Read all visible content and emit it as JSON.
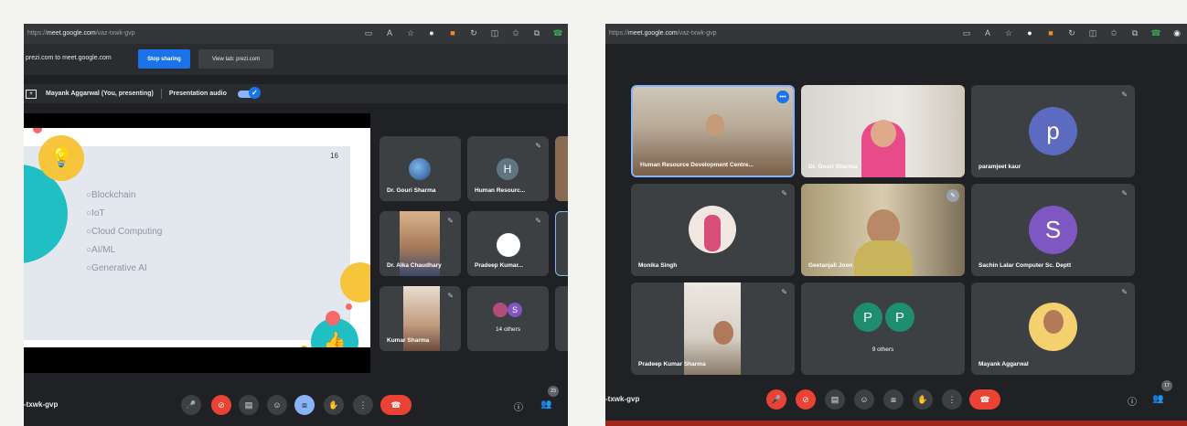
{
  "left": {
    "url": {
      "prefix": "https://",
      "host": "meet.google.com",
      "path": "/vaz-txwk-gvp"
    },
    "share": {
      "message": "prezi.com to meet.google.com",
      "stop": "Stop sharing",
      "view": "View tab: prezi.com"
    },
    "presenting": {
      "name": "Mayank Aggarwal (You, presenting)",
      "audio": "Presentation audio"
    },
    "slide": {
      "number": "16",
      "bullets": [
        "Blockchain",
        "IoT",
        "Cloud Computing",
        "AI/ML",
        "Generative AI"
      ]
    },
    "tiles": {
      "t1": "Dr. Gouri Sharma",
      "t2": {
        "letter": "H",
        "name": "Human Resourc..."
      },
      "t4": "Dr. Alka Chaudhary",
      "t5": "Pradeep Kumar...",
      "t6": "Kumar Sharma",
      "t7": {
        "letter": "S",
        "name": "14 others"
      }
    },
    "code": "-txwk-gvp",
    "badge": "23"
  },
  "right": {
    "url": {
      "prefix": "https://",
      "host": "meet.google.com",
      "path": "/vaz-txwk-gvp"
    },
    "tiles": {
      "t1": "Human Resource Development Centre...",
      "t2": "Dr. Gouri Sharma",
      "t3": {
        "letter": "p",
        "name": "paramjeet kaur"
      },
      "t4": "Monika Singh",
      "t5": "Geetanjali Joon",
      "t6": {
        "letter": "S",
        "name": "Sachin Lalar Computer Sc. Deptt"
      },
      "t7": "Pradeep Kumar Sharma",
      "t8": {
        "letters": [
          "P",
          "P"
        ],
        "name": "9 others"
      },
      "t9": "Mayank Aggarwal"
    },
    "code": "-txwk-gvp",
    "badge": "17"
  },
  "colors": {
    "accent": "#1a73e8",
    "danger": "#ea4335",
    "tile": "#3c4043",
    "background": "#202124"
  }
}
